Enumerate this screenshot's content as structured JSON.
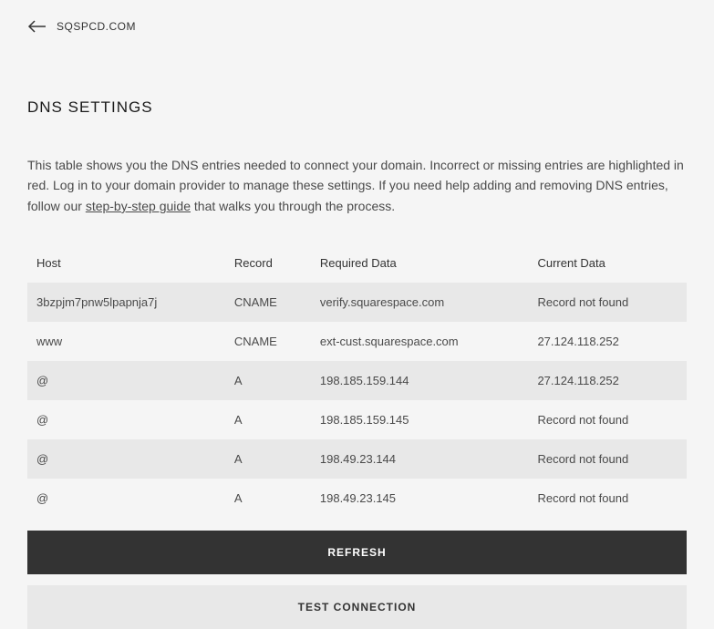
{
  "header": {
    "domain": "SQSPCD.COM"
  },
  "page": {
    "title": "DNS SETTINGS",
    "description_before": "This table shows you the DNS entries needed to connect your domain. Incorrect or missing entries are highlighted in red. Log in to your domain provider to manage these settings. If you need help adding and removing DNS entries, follow our ",
    "guide_link_text": "step-by-step guide",
    "description_after": " that walks you through the process."
  },
  "table": {
    "headers": {
      "host": "Host",
      "record": "Record",
      "required": "Required Data",
      "current": "Current Data"
    },
    "rows": [
      {
        "host": "3bzpjm7pnw5lpapnja7j",
        "record": "CNAME",
        "required": "verify.squarespace.com",
        "current": "Record not found",
        "error": true
      },
      {
        "host": "www",
        "record": "CNAME",
        "required": "ext-cust.squarespace.com",
        "current": "27.124.118.252",
        "error": true
      },
      {
        "host": "@",
        "record": "A",
        "required": "198.185.159.144",
        "current": "27.124.118.252",
        "error": true
      },
      {
        "host": "@",
        "record": "A",
        "required": "198.185.159.145",
        "current": "Record not found",
        "error": true
      },
      {
        "host": "@",
        "record": "A",
        "required": "198.49.23.144",
        "current": "Record not found",
        "error": true
      },
      {
        "host": "@",
        "record": "A",
        "required": "198.49.23.145",
        "current": "Record not found",
        "error": true
      }
    ]
  },
  "buttons": {
    "refresh": "REFRESH",
    "test_connection": "TEST CONNECTION"
  }
}
